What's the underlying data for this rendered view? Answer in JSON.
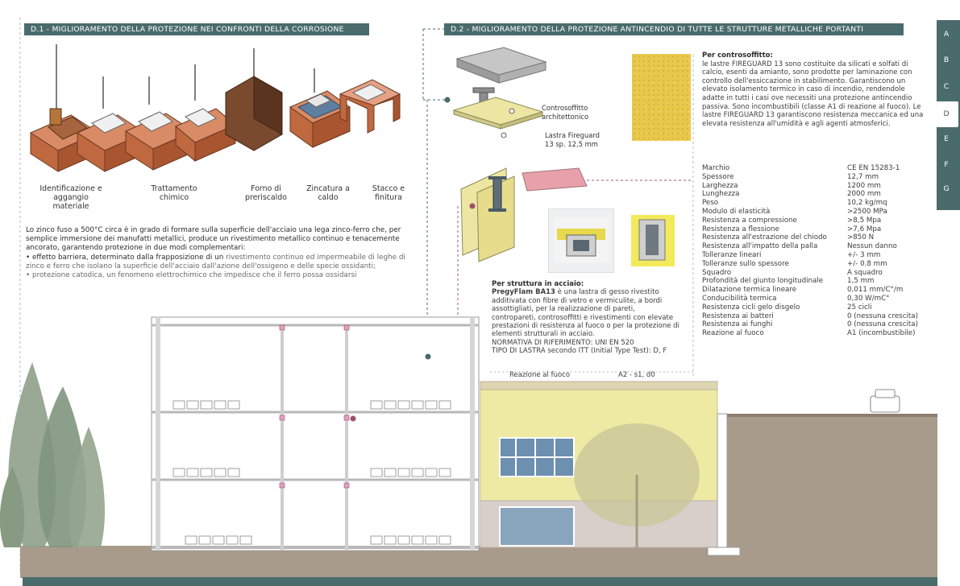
{
  "sections": {
    "d1_title": "D.1 - MIGLIORAMENTO DELLA PROTEZIONE NEI CONFRONTI DELLA CORROSIONE",
    "d2_title": "D.2 - MIGLIORAMENTO DELLA PROTEZIONE ANTINCENDIO  DI TUTTE LE STRUTTURE METALLICHE PORTANTI"
  },
  "process_steps": [
    "Identificazione e aggangio materiale",
    "Trattamento chimico",
    "Forno di preriscaldo",
    "Zincatura a caldo",
    "Stacco e finitura"
  ],
  "d1_paragraph": {
    "intro": "Lo zinco fuso a 500°C circa è in grado di formare sulla superficie dell'acciaio una lega zinco-ferro che, per semplice immersione dei manufatti metallici, produce un rivestimento metallico continuo e tenacemente ancorato, garantendo protezione in due modi complementari:",
    "b1_strong": "• effetto barriera, determinato dalla frapposizione di un",
    "b1_rest": " rivestimento continuo ed impermeabile di leghe di zinco e ferro che isolano la superficie dell'acciaio dall'azione dell'ossigeno e delle specie ossidanti;",
    "b2": "• protezione catodica, un fenomeno elettrochimico che impedisce che il ferro possa ossidarsi"
  },
  "ceiling_labels": {
    "contro": "Controsoffitto architettonico",
    "lastra_line1": "Lastra Fireguard",
    "lastra_line2": "13 sp. 12,5 mm"
  },
  "fireguard_text": {
    "title": "Per controsoffitto:",
    "body": "le lastre FIREGUARD 13 sono costituite da silicati e solfati di calcio, esenti da amianto, sono prodotte per laminazione con controllo dell'essiccazione in stabilimento. Garantiscono un elevato isolamento termico in caso di incendio, rendendole adatte in tutti i casi ove necessiti una protezione antincendio passiva. Sono incombustibili (classe A1 di reazione al fuoco). Le lastre FIREGUARD 13 garantiscono resistenza meccanica ed una elevata resistenza all'umidità e agli agenti atmosferici."
  },
  "acciaio_text": {
    "title": "Per struttura in acciaio:",
    "product": "PregyFlam BA13",
    "body": " è una lastra di gesso rivestito additivata con fibre di vetro e vermiculite, a bordi assottigliati, per la realizzazione di pareti, contropareti, controsoffitti e rivestimenti con elevate prestazioni di resistenza al fuoco o per la protezione di elementi strutturali in acciaio.",
    "norm1": "NORMATIVA DI RIFERIMENTO: UNI EN 520",
    "norm2": "TIPO DI LASTRA secondo ITT (Initial Type Test): D, F",
    "reazione_label": "Reazione al fuoco",
    "reazione_value": "A2 - s1, d0"
  },
  "specs": [
    {
      "k": "Marchio",
      "v": "CE EN 15283-1"
    },
    {
      "k": "Spessore",
      "v": "12,7 mm"
    },
    {
      "k": "Larghezza",
      "v": "1200 mm"
    },
    {
      "k": "Lunghezza",
      "v": "2000 mm"
    },
    {
      "k": "Peso",
      "v": "10,2 kg/mq"
    },
    {
      "k": "Modulo di elasticità",
      "v": ">2500 MPa"
    },
    {
      "k": "Resistenza a compressione",
      "v": ">8,5 Mpa"
    },
    {
      "k": "Resistenza a flessione",
      "v": ">7,6 Mpa"
    },
    {
      "k": "Resistenza all'estrazione del chiodo",
      "v": ">850 N"
    },
    {
      "k": "Resistenza all'impatto della palla",
      "v": "Nessun danno"
    },
    {
      "k": "Tolleranze lineari",
      "v": "+/- 3 mm"
    },
    {
      "k": "Tolleranze sullo spessore",
      "v": "+/- 0.8 mm"
    },
    {
      "k": "Squadro",
      "v": "A squadro"
    },
    {
      "k": "Profondità del giunto longitudinale",
      "v": "1,5 mm"
    },
    {
      "k": "Dilatazione termica lineare",
      "v": "0,011 mm/C°/m"
    },
    {
      "k": "Conducibilità termica",
      "v": "0,30 W/mC°"
    },
    {
      "k": "Resistenza cicli gelo disgelo",
      "v": "25 cicli"
    },
    {
      "k": "Resistenza ai batteri",
      "v": "0 (nessuna crescita)"
    },
    {
      "k": "Resistenza ai funghi",
      "v": "0 (nessuna crescita)"
    },
    {
      "k": "Reazione al fuoco",
      "v": "A1 (incombustibile)"
    }
  ],
  "tabs": [
    "A",
    "B",
    "C",
    "D",
    "E",
    "F",
    "G"
  ],
  "active_tab": "D",
  "colors": {
    "teal": "#4a6b6b",
    "brick": "#c9704e",
    "fireguard": "#e8c84a",
    "pink_marker": "#a0506e",
    "ground": "#a89a8a",
    "wall_yellow": "#eeeaa4"
  }
}
